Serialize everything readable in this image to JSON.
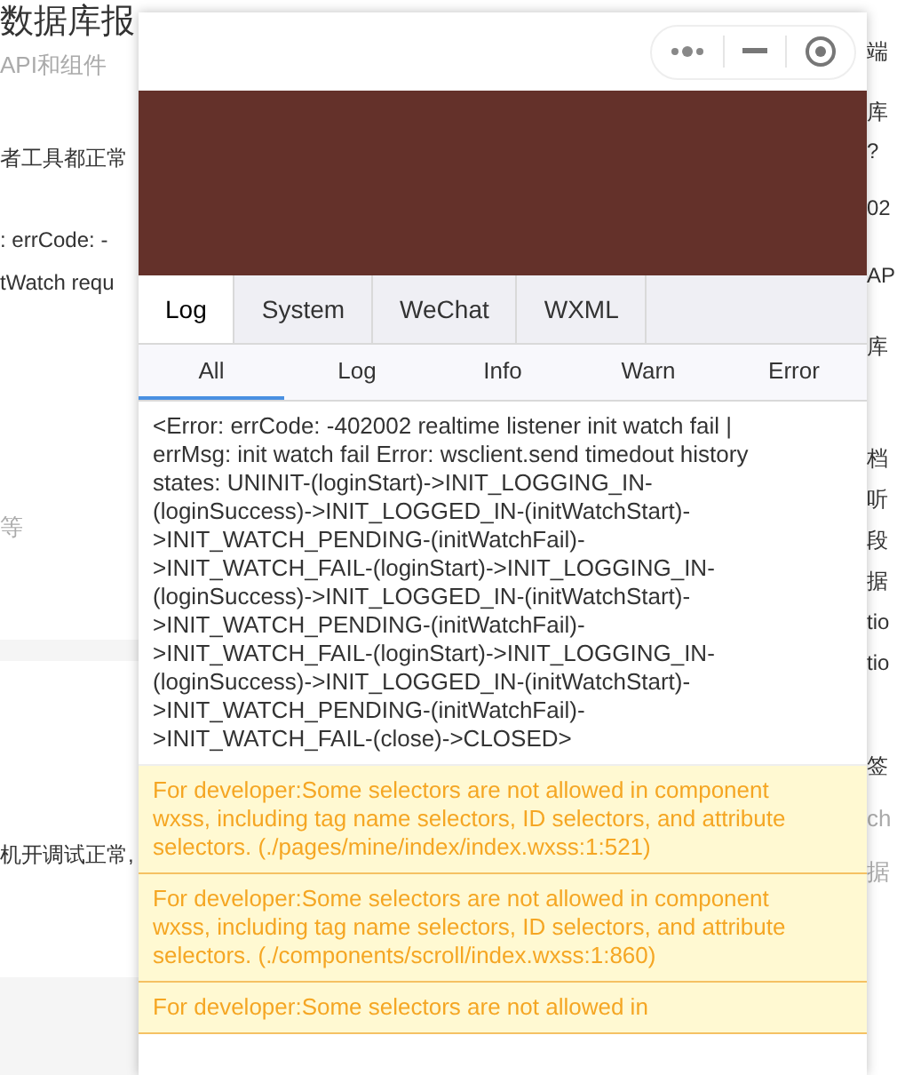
{
  "background_page": {
    "left": [
      {
        "kind": "title",
        "text": "数据库报"
      },
      {
        "kind": "muted",
        "text": "API和组件"
      },
      {
        "kind": "body",
        "text": "者工具都正常"
      },
      {
        "kind": "body",
        "text": ": errCode: -"
      },
      {
        "kind": "body",
        "text": "tWatch requ"
      },
      {
        "kind": "muted",
        "text": "等"
      },
      {
        "kind": "body",
        "text": "机开调试正常,"
      }
    ],
    "right": [
      {
        "kind": "body",
        "text": "端"
      },
      {
        "kind": "body",
        "text": "库"
      },
      {
        "kind": "body",
        "text": "?"
      },
      {
        "kind": "body",
        "text": "02"
      },
      {
        "kind": "body",
        "text": "AP"
      },
      {
        "kind": "body",
        "text": "库"
      },
      {
        "kind": "body",
        "text": "档"
      },
      {
        "kind": "body",
        "text": "听"
      },
      {
        "kind": "body",
        "text": "段"
      },
      {
        "kind": "body",
        "text": "据"
      },
      {
        "kind": "body",
        "text": "tio"
      },
      {
        "kind": "body",
        "text": "tio"
      },
      {
        "kind": "body",
        "text": "签"
      },
      {
        "kind": "muted",
        "text": "ch"
      },
      {
        "kind": "muted",
        "text": "据"
      }
    ]
  },
  "console": {
    "tabs": [
      {
        "label": "Log",
        "selected": true
      },
      {
        "label": "System",
        "selected": false
      },
      {
        "label": "WeChat",
        "selected": false
      },
      {
        "label": "WXML",
        "selected": false
      }
    ],
    "filters": [
      {
        "label": "All",
        "selected": true
      },
      {
        "label": "Log",
        "selected": false
      },
      {
        "label": "Info",
        "selected": false
      },
      {
        "label": "Warn",
        "selected": false
      },
      {
        "label": "Error",
        "selected": false
      }
    ],
    "entries": [
      {
        "kind": "log",
        "text": "<Error: errCode: -402002 realtime listener init watch fail | errMsg: init watch fail Error: wsclient.send timedout history states: UNINIT-(loginStart)->INIT_LOGGING_IN-(loginSuccess)->INIT_LOGGED_IN-(initWatchStart)->INIT_WATCH_PENDING-(initWatchFail)->INIT_WATCH_FAIL-(loginStart)->INIT_LOGGING_IN-(loginSuccess)->INIT_LOGGED_IN-(initWatchStart)->INIT_WATCH_PENDING-(initWatchFail)->INIT_WATCH_FAIL-(loginStart)->INIT_LOGGING_IN-(loginSuccess)->INIT_LOGGED_IN-(initWatchStart)->INIT_WATCH_PENDING-(initWatchFail)->INIT_WATCH_FAIL-(close)->CLOSED>"
      },
      {
        "kind": "warn",
        "text": "For developer:Some selectors are not allowed in component wxss, including tag name selectors, ID selectors, and attribute selectors. (./pages/mine/index/index.wxss:1:521)"
      },
      {
        "kind": "warn",
        "text": "For developer:Some selectors are not allowed in component wxss, including tag name selectors, ID selectors, and attribute selectors. (./components/scroll/index.wxss:1:860)"
      },
      {
        "kind": "warn",
        "text": "For developer:Some selectors are not allowed in"
      }
    ]
  }
}
